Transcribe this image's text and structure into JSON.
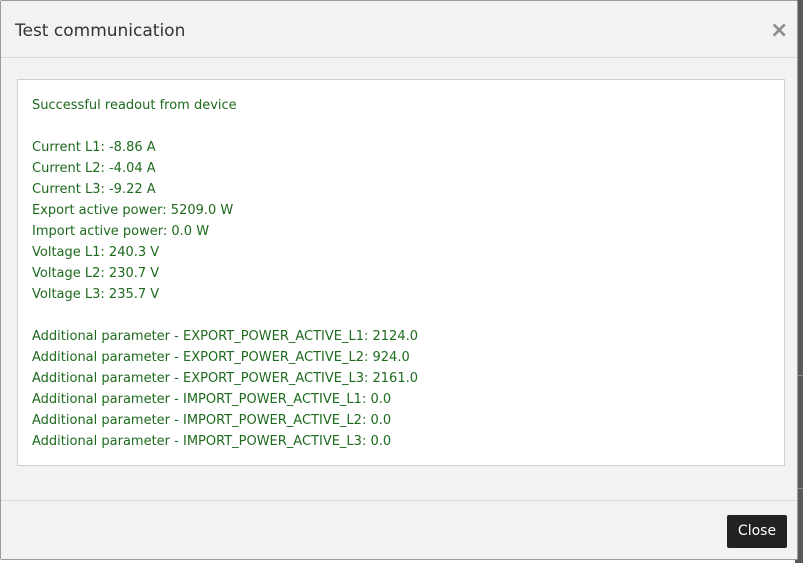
{
  "dialog": {
    "title": "Test communication",
    "close_icon": "×",
    "close_label": "Close"
  },
  "result": {
    "status": "Successful readout from device",
    "measurements": [
      "Current L1: -8.86 A",
      "Current L2: -4.04 A",
      "Current L3: -9.22 A",
      "Export active power: 5209.0 W",
      "Import active power: 0.0 W",
      "Voltage L1: 240.3 V",
      "Voltage L2: 230.7 V",
      "Voltage L3: 235.7 V"
    ],
    "additional": [
      "Additional parameter - EXPORT_POWER_ACTIVE_L1: 2124.0",
      "Additional parameter - EXPORT_POWER_ACTIVE_L2: 924.0",
      "Additional parameter - EXPORT_POWER_ACTIVE_L3: 2161.0",
      "Additional parameter - IMPORT_POWER_ACTIVE_L1: 0.0",
      "Additional parameter - IMPORT_POWER_ACTIVE_L2: 0.0",
      "Additional parameter - IMPORT_POWER_ACTIVE_L3: 0.0"
    ]
  },
  "colors": {
    "text_success": "#1e6a1e",
    "button_bg": "#222222"
  }
}
